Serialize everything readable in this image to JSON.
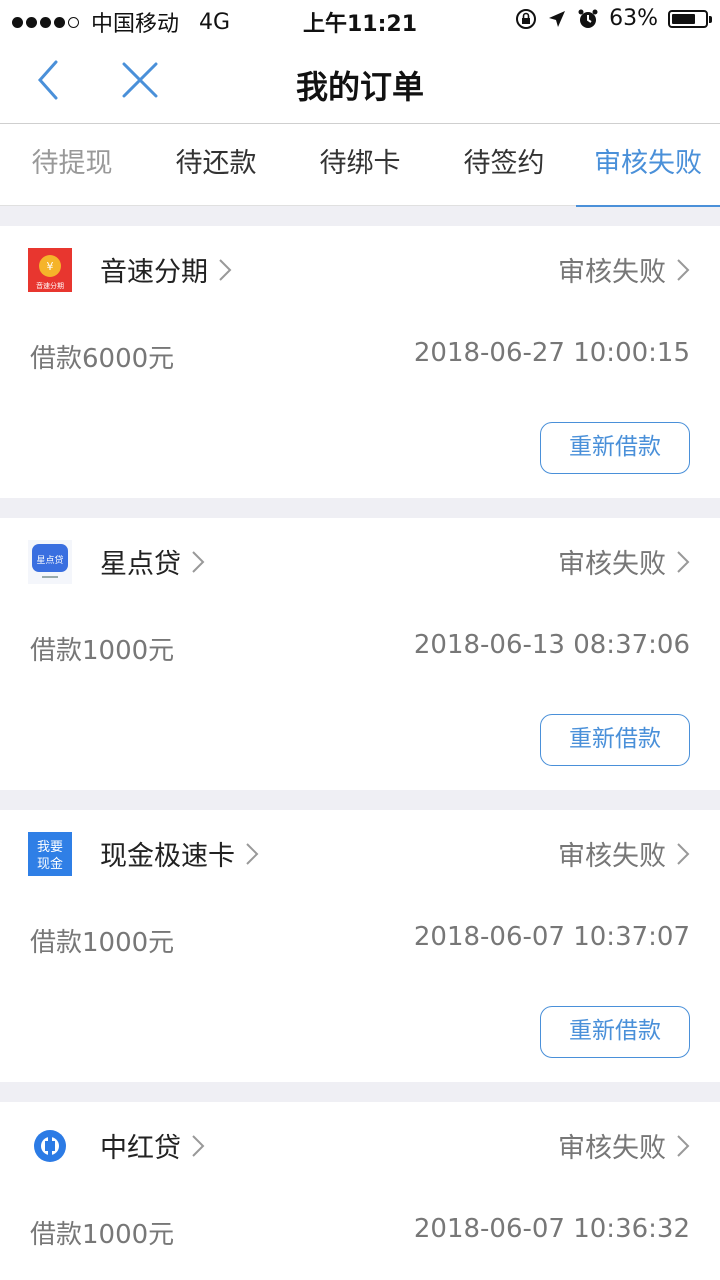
{
  "status_bar": {
    "carrier": "中国移动",
    "network": "4G",
    "time": "上午11:21",
    "battery": "63%"
  },
  "nav": {
    "title": "我的订单",
    "back_icon": "chevron-left-icon",
    "close_icon": "close-icon"
  },
  "tabs": [
    {
      "label": "待提现"
    },
    {
      "label": "待还款"
    },
    {
      "label": "待绑卡"
    },
    {
      "label": "待签约"
    },
    {
      "label": "审核失败"
    }
  ],
  "active_tab": 4,
  "accent_color": "#4a90d9",
  "orders": [
    {
      "name": "音速分期",
      "status": "审核失败",
      "amount": "借款6000元",
      "time": "2018-06-27 10:00:15",
      "button": "重新借款",
      "logo": "yinsu-logo-icon",
      "logo_text": "音速分期"
    },
    {
      "name": "星点贷",
      "status": "审核失败",
      "amount": "借款1000元",
      "time": "2018-06-13 08:37:06",
      "button": "重新借款",
      "logo": "xingdian-logo-icon",
      "logo_text": "星点贷"
    },
    {
      "name": "现金极速卡",
      "status": "审核失败",
      "amount": "借款1000元",
      "time": "2018-06-07 10:37:07",
      "button": "重新借款",
      "logo": "xianjin-logo-icon",
      "logo_text": "我要现金"
    },
    {
      "name": "中红贷",
      "status": "审核失败",
      "amount": "借款1000元",
      "time": "2018-06-07 10:36:32",
      "button": "",
      "logo": "zhonghong-logo-icon"
    }
  ]
}
